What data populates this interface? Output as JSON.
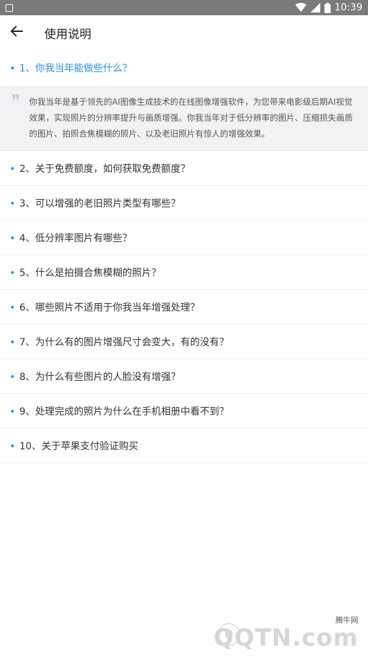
{
  "status_bar": {
    "time": "10:39"
  },
  "header": {
    "title": "使用说明"
  },
  "faq": [
    {
      "question": "1、你我当年能做些什么？",
      "active": true,
      "answer": "你我当年是基于领先的AI图像生成技术的在线图像增强软件，为您带来电影级后期AI视觉效果，实现照片的分辨率提升与画质增强。你我当年对于低分辨率的图片、压缩损失画质的图片、拍照合焦模糊的照片、以及老旧照片有惊人的增强效果。"
    },
    {
      "question": "2、关于免费额度，如何获取免费额度？"
    },
    {
      "question": "3、可以增强的老旧照片类型有哪些？"
    },
    {
      "question": "4、低分辨率图片有哪些？"
    },
    {
      "question": "5、什么是拍摄合焦模糊的照片？"
    },
    {
      "question": "6、哪些照片不适用于你我当年增强处理？"
    },
    {
      "question": "7、为什么有的图片增强尺寸会变大，有的没有？"
    },
    {
      "question": "8、为什么有些图片的人脸没有增强？"
    },
    {
      "question": "9、处理完成的照片为什么在手机相册中看不到？"
    },
    {
      "question": "10、关于苹果支付验证购买"
    }
  ],
  "watermark": {
    "site_label": "腾牛网",
    "logo_text": "QQTN.com"
  },
  "colors": {
    "accent": "#2a8fdc",
    "status_bar": "#7a7a7a",
    "answer_bg": "#f1f2f4"
  },
  "icons": {
    "back": "arrow-left-icon",
    "quote": "quote-icon"
  }
}
